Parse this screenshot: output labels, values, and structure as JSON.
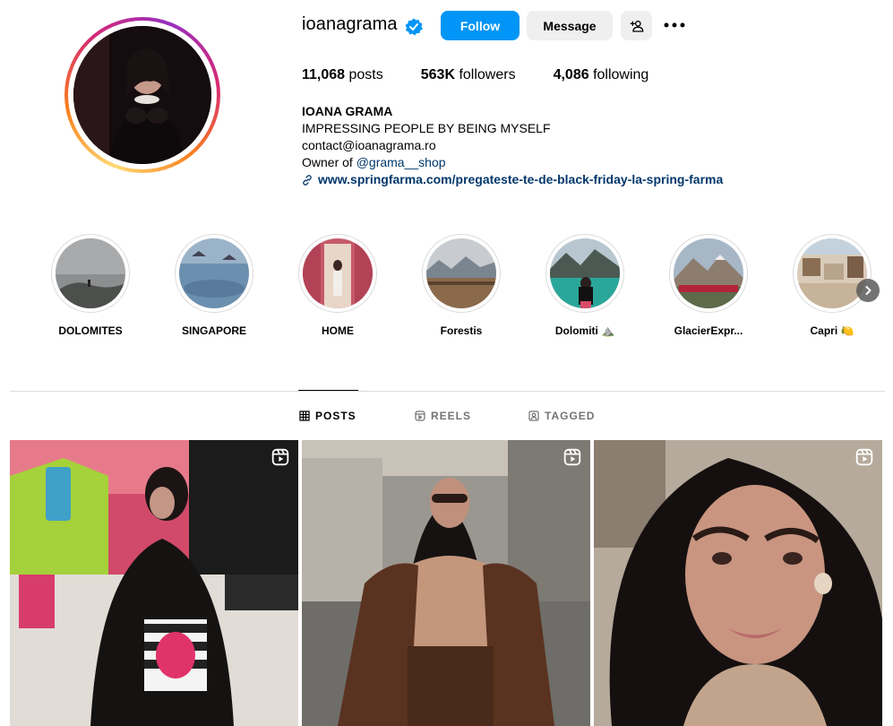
{
  "profile": {
    "username": "ioanagrama",
    "follow_label": "Follow",
    "message_label": "Message",
    "stats": {
      "posts_count": "11,068",
      "posts_label": " posts",
      "followers_count": "563K",
      "followers_label": " followers",
      "following_count": "4,086",
      "following_label": " following"
    },
    "bio": {
      "name": "IOANA GRAMA",
      "tagline": "IMPRESSING PEOPLE BY BEING MYSELF",
      "email": "contact@ioanagrama.ro",
      "owner_prefix": "Owner of ",
      "owner_mention": "@grama__shop",
      "link": "www.springfarma.com/pregateste-te-de-black-friday-la-spring-farma"
    }
  },
  "highlights": [
    {
      "label": "DOLOMITES"
    },
    {
      "label": "SINGAPORE"
    },
    {
      "label": "HOME"
    },
    {
      "label": "Forestis"
    },
    {
      "label": "Dolomiti ⛰️"
    },
    {
      "label": "GlacierExpr..."
    },
    {
      "label": "Capri 🍋"
    }
  ],
  "tabs": {
    "posts": "POSTS",
    "reels": "REELS",
    "tagged": "TAGGED"
  },
  "colors": {
    "accent": "#0095f6",
    "link": "#00376b",
    "button_secondary": "#efefef",
    "divider": "#dbdbdb"
  },
  "icons": {
    "verified": "verified-badge-icon",
    "suggest": "add-person-icon",
    "more": "more-options-icon",
    "link": "link-icon",
    "posts_tab": "grid-icon",
    "reels_tab": "reels-icon",
    "tagged_tab": "tagged-icon",
    "reel_badge": "reel-icon",
    "next": "chevron-right-icon"
  }
}
